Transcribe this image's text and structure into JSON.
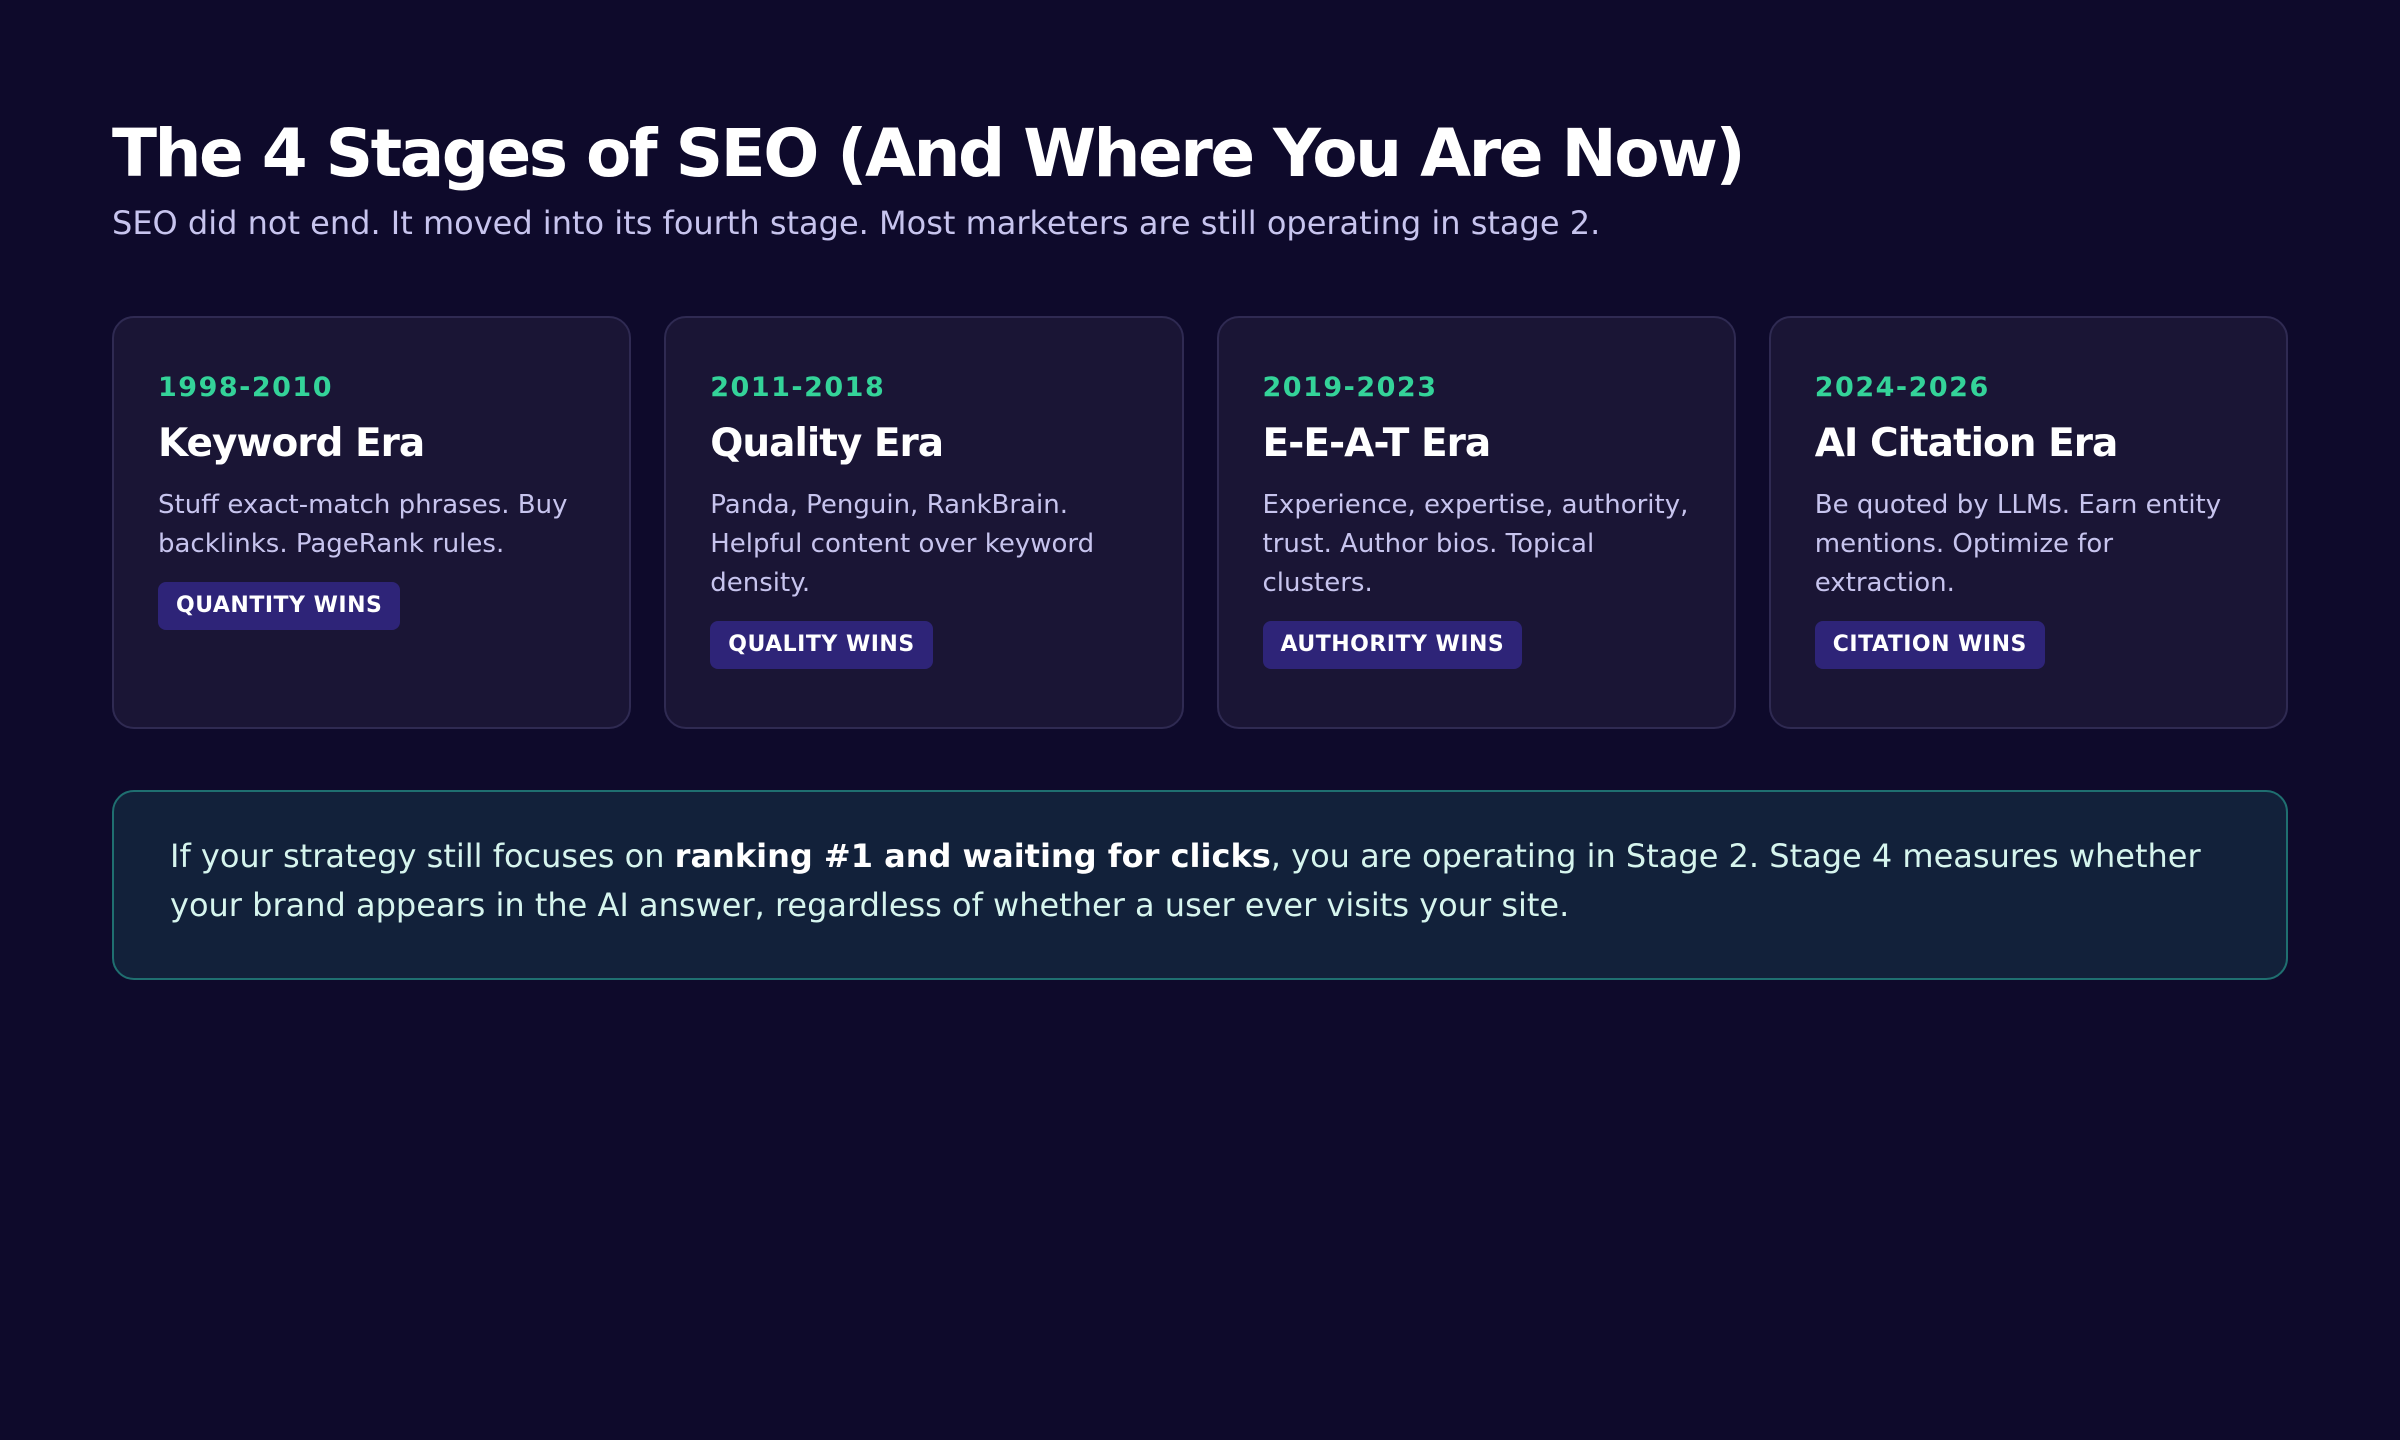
{
  "header": {
    "title": "The 4 Stages of SEO (And Where You Are Now)",
    "subtitle": "SEO did not end. It moved into its fourth stage. Most marketers are still operating in stage 2."
  },
  "stages": [
    {
      "years": "1998-2010",
      "name": "Keyword Era",
      "description": "Stuff exact-match phrases. Buy backlinks. PageRank rules.",
      "badge": "QUANTITY WINS"
    },
    {
      "years": "2011-2018",
      "name": "Quality Era",
      "description": "Panda, Penguin, RankBrain. Helpful content over keyword density.",
      "badge": "QUALITY WINS"
    },
    {
      "years": "2019-2023",
      "name": "E-E-A-T Era",
      "description": "Experience, expertise, authority, trust. Author bios. Topical clusters.",
      "badge": "AUTHORITY WINS"
    },
    {
      "years": "2024-2026",
      "name": "AI Citation Era",
      "description": "Be quoted by LLMs. Earn entity mentions. Optimize for extraction.",
      "badge": "CITATION WINS"
    }
  ],
  "callout": {
    "before": "If your strategy still focuses on ",
    "emphasis": "ranking #1 and waiting for clicks",
    "after": ", you are operating in Stage 2. Stage 4 measures whether your brand appears in the AI answer, regardless of whether a user ever visits your site."
  },
  "colors": {
    "background": "#0e0a2b",
    "card_background": "#1a1535",
    "accent_green": "#34d399",
    "badge_background": "#2e2478",
    "callout_background": "#12213a",
    "callout_border": "#1f6f70"
  }
}
